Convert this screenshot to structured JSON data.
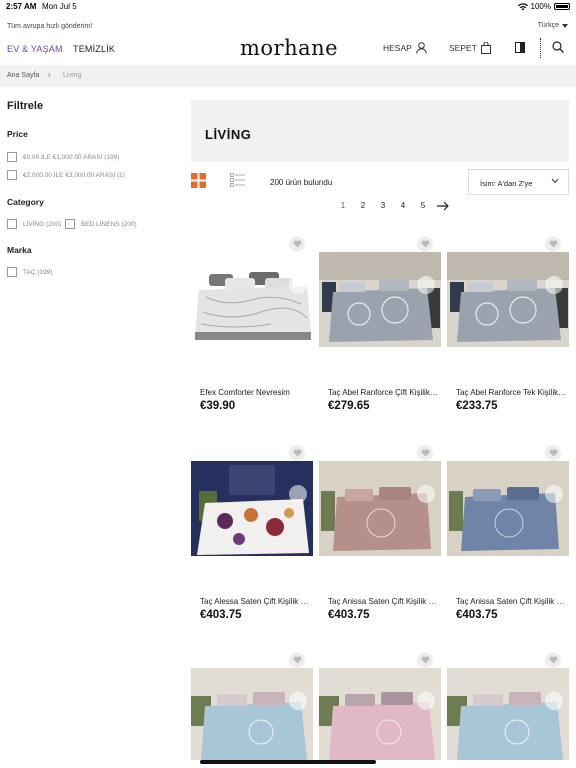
{
  "status": {
    "time": "2:57 AM",
    "date": "Mon Jul 5",
    "battery": "100%"
  },
  "topbar": {
    "shipping": "Tüm avrupa hızlı gönderim!",
    "language": "Türkçe"
  },
  "header": {
    "nav": [
      {
        "label": "EV & YAŞAM"
      },
      {
        "label": "TEMİZLİK"
      }
    ],
    "logo": "morhane",
    "account_label": "HESAP",
    "cart_label": "SEPET"
  },
  "breadcrumb": {
    "home": "Ana Sayfa",
    "separator": "›",
    "current": "Living"
  },
  "filters": {
    "title": "Filtrele",
    "sections": [
      {
        "title": "Price",
        "options": [
          "€0.00 İLE €1,000.00 ARASI (199)",
          "€2,000.00 İLE €3,000.00 ARASI (1)"
        ]
      },
      {
        "title": "Category",
        "options": [
          "LİVİNG (200)",
          "BED LİNENS (200)"
        ]
      },
      {
        "title": "Marka",
        "options": [
          "TAÇ (199)"
        ]
      }
    ]
  },
  "listing": {
    "title": "LİVİNG",
    "count": "200 ürün bulundu",
    "sort": "İsim: A'dan Z'ye",
    "pages": [
      "1",
      "2",
      "3",
      "4",
      "5"
    ],
    "current_page": "1",
    "accent_color": "#e8692c"
  },
  "products": [
    {
      "name": "Efex Comforter Nevresim",
      "price": "€39.90",
      "image_icon": "bedding-grey-white-photo"
    },
    {
      "name": "Taç Abel Ranforce Çift Kişilik Nevresim",
      "price": "€279.65",
      "image_icon": "bedding-grey-medallion-photo"
    },
    {
      "name": "Taç Abel Ranforce Tek Kişilik Nevresim",
      "price": "€233.75",
      "image_icon": "bedding-grey-medallion-photo"
    },
    {
      "name": "Taç Alessa Saten Çift Kişilik Nevresim",
      "price": "€403.75",
      "image_icon": "bedding-floral-photo"
    },
    {
      "name": "Taç Anissa Saten Çift Kişilik Nevresim",
      "price": "€403.75",
      "image_icon": "bedding-pink-photo"
    },
    {
      "name": "Taç Anissa Saten Çift Kişilik Nevresim",
      "price": "€403.75",
      "image_icon": "bedding-blue-photo"
    },
    {
      "name": "",
      "price": "",
      "image_icon": "bedding-light-blue-photo"
    },
    {
      "name": "",
      "price": "",
      "image_icon": "bedding-pink-photo"
    },
    {
      "name": "",
      "price": "",
      "image_icon": "bedding-light-blue-photo"
    }
  ]
}
